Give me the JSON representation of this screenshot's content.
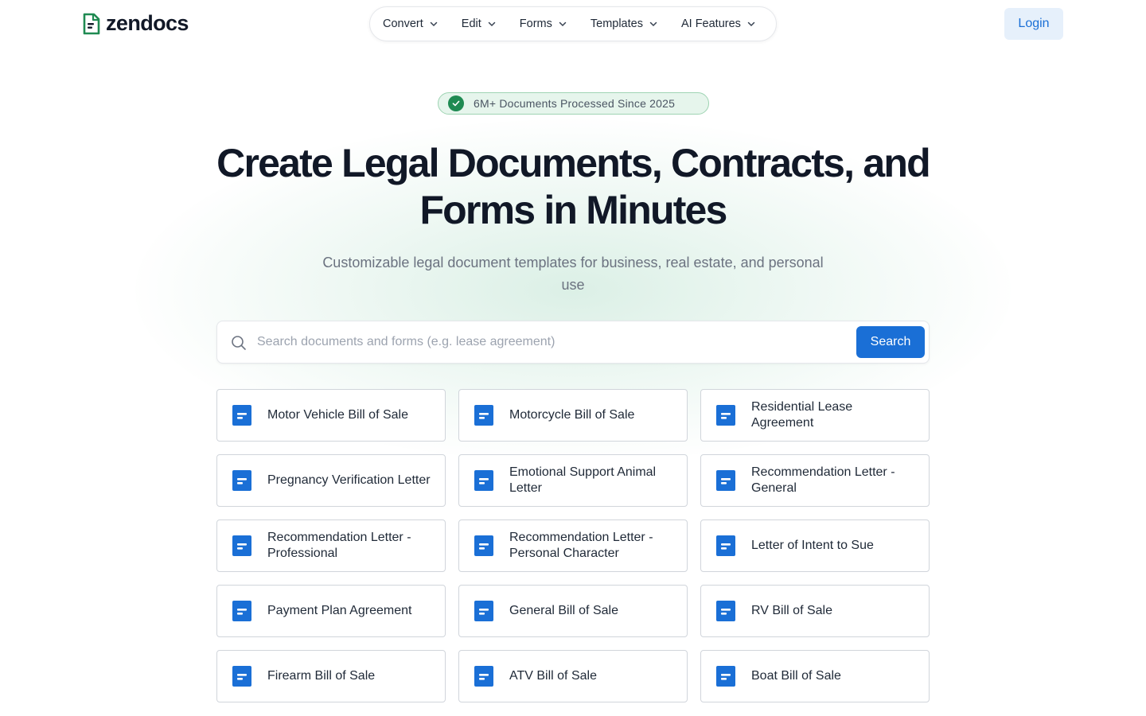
{
  "header": {
    "logo_text": "zendocs",
    "nav": [
      {
        "label": "Convert"
      },
      {
        "label": "Edit"
      },
      {
        "label": "Forms"
      },
      {
        "label": "Templates"
      },
      {
        "label": "AI Features"
      }
    ],
    "login_label": "Login"
  },
  "hero": {
    "badge_text": "6M+ Documents Processed Since 2025",
    "title_line1": "Create Legal Documents, Contracts, and",
    "title_line2": "Forms in Minutes",
    "subtitle": "Customizable legal document templates for business, real estate, and personal use"
  },
  "search": {
    "placeholder": "Search documents and forms (e.g. lease agreement)",
    "button_label": "Search"
  },
  "documents": [
    {
      "label": "Motor Vehicle Bill of Sale"
    },
    {
      "label": "Motorcycle Bill of Sale"
    },
    {
      "label": "Residential Lease Agreement"
    },
    {
      "label": "Pregnancy Verification Letter"
    },
    {
      "label": "Emotional Support Animal Letter"
    },
    {
      "label": "Recommendation Letter - General"
    },
    {
      "label": "Recommendation Letter - Professional"
    },
    {
      "label": "Recommendation Letter - Personal Character"
    },
    {
      "label": "Letter of Intent to Sue"
    },
    {
      "label": "Payment Plan Agreement"
    },
    {
      "label": "General Bill of Sale"
    },
    {
      "label": "RV Bill of Sale"
    },
    {
      "label": "Firearm Bill of Sale"
    },
    {
      "label": "ATV Bill of Sale"
    },
    {
      "label": "Boat Bill of Sale"
    }
  ],
  "colors": {
    "brand_green": "#1f8a52",
    "accent_blue": "#1a6fd6",
    "login_bg": "#e6f0fb",
    "badge_bg": "#e6f5ec"
  },
  "icons": {
    "logo": "document-logo-icon",
    "nav": "chevron-down-icon",
    "badge": "check-circle-icon",
    "search": "search-icon",
    "card": "document-icon"
  }
}
